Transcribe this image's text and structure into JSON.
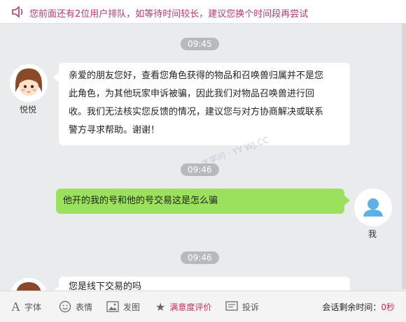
{
  "notice": {
    "text": "您前面还有2位用户排队，如等待时间较长，建议您换个时间段再尝试",
    "icon": "speaker-icon"
  },
  "messages": [
    {
      "time": "09:45",
      "sender": "悦悦",
      "side": "left",
      "text_lines": [
        "亲爱的朋友您好，查看您角色获得的物品和召唤兽归属并不是您",
        "此角色，为其他玩家申诉被骗，因此我们对物品召唤兽进行回",
        "收。我们无法核实您反馈的情况，建议您与对方协商解决或联系",
        "警方寻求帮助。谢谢！"
      ]
    },
    {
      "time": "09:46",
      "sender": "我",
      "side": "right",
      "text": "他开的我的号和他的号交易这是怎么骗"
    },
    {
      "time": "09:46",
      "sender": "悦悦",
      "side": "left",
      "text": "您是线下交易的吗"
    }
  ],
  "watermark": "明 · 大学问 · YY WJ.CC",
  "toolbar": {
    "font": "字体",
    "emoji": "表情",
    "image": "发图",
    "rating": "满意度评价",
    "complaint": "投诉",
    "countdown_label": "会话剩余时间：",
    "countdown_value": "0秒"
  },
  "colors": {
    "notice_text": "#b23a6a",
    "right_bubble": "#9be15d",
    "accent": "#c62f5b",
    "background": "#eaebed"
  }
}
